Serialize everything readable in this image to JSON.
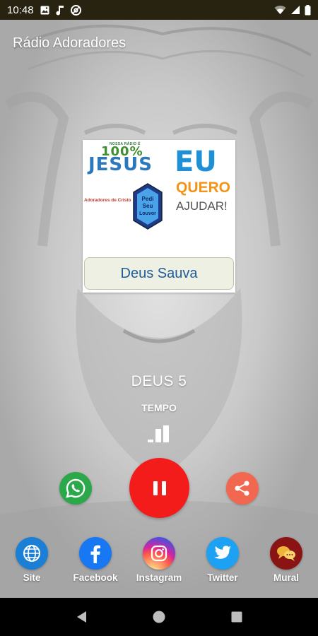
{
  "status_bar": {
    "time": "10:48",
    "icons_left": [
      "photo-icon",
      "music-note-icon",
      "at-sign-icon"
    ],
    "icons_right": [
      "wifi-icon",
      "signal-icon",
      "battery-icon"
    ]
  },
  "app": {
    "title": "Rádio Adoradores"
  },
  "artwork": {
    "small_tag": "NOSSA RÁDIO É",
    "hundred": "100%",
    "jesus": "JESUS",
    "eu": "EU",
    "quero": "QUERO",
    "ajudar": "AJUDAR!",
    "adoradores": "Adoradores de Cristo",
    "badge_text": "Pedi Seu Louvor",
    "button_label": "Deus Sauva"
  },
  "player": {
    "track_title": "DEUS 5",
    "track_subtitle": "TEMPO",
    "state": "playing"
  },
  "social": {
    "items": [
      {
        "label": "Site",
        "icon": "globe-icon",
        "color": "#1c7fd6"
      },
      {
        "label": "Facebook",
        "icon": "facebook-icon",
        "color": "#1877f2"
      },
      {
        "label": "Instagram",
        "icon": "instagram-icon",
        "color": "#d6249f"
      },
      {
        "label": "Twitter",
        "icon": "twitter-icon",
        "color": "#1da1f2"
      },
      {
        "label": "Mural",
        "icon": "chat-bubbles-icon",
        "color": "#8a1414"
      }
    ]
  },
  "colors": {
    "status_bar": "#272310",
    "play_button": "#f41b1b",
    "whatsapp": "#2aa84a",
    "share": "#f2674f"
  }
}
